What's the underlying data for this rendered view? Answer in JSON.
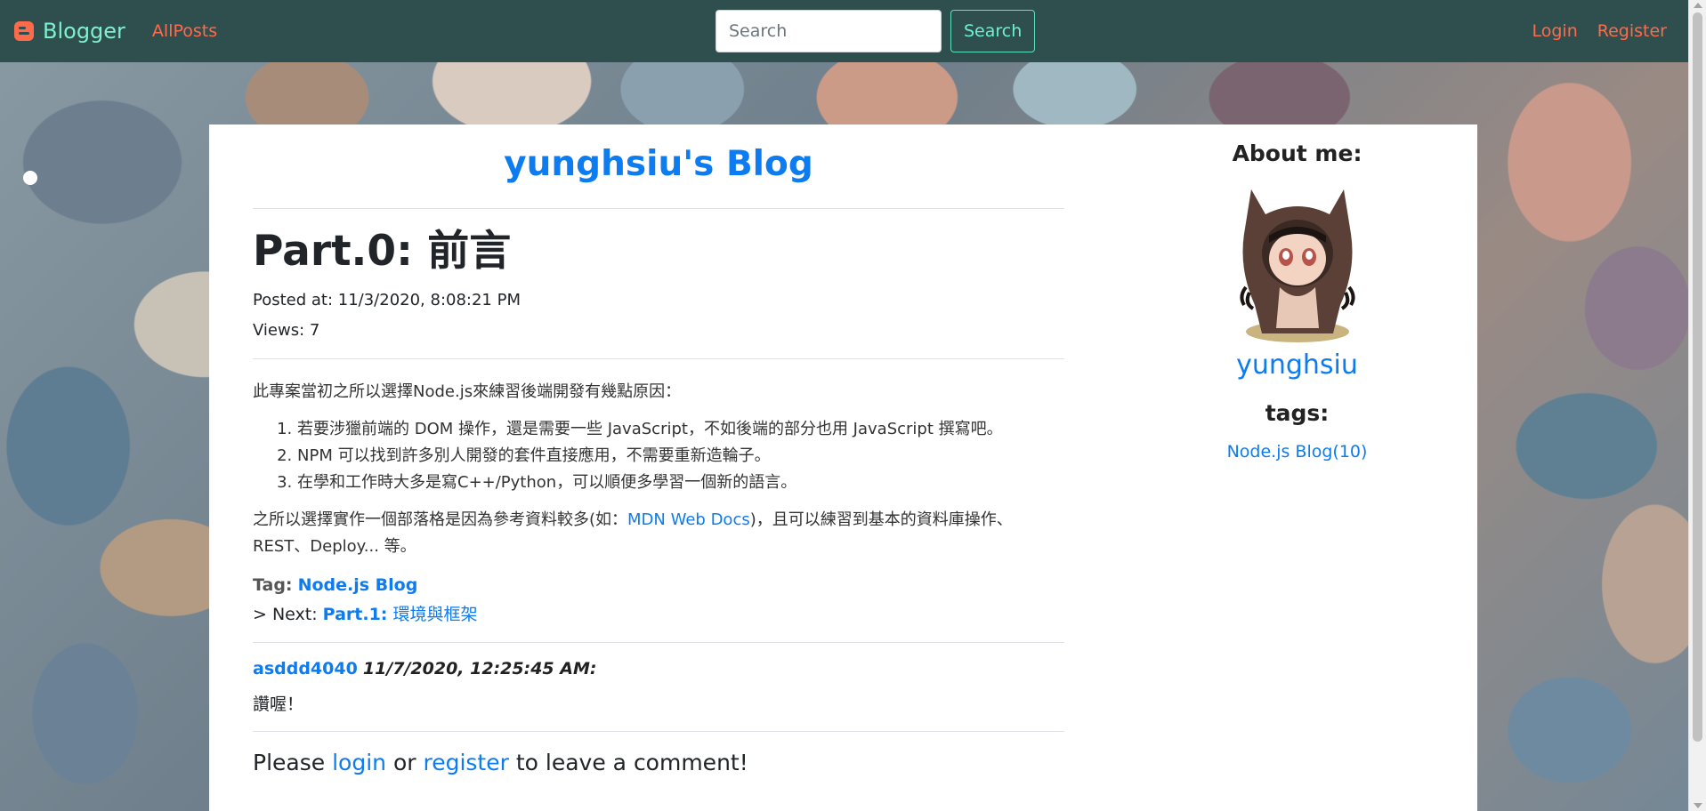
{
  "navbar": {
    "brand": "Blogger",
    "all_posts": "AllPosts",
    "search_placeholder": "Search",
    "search_button": "Search",
    "login": "Login",
    "register": "Register"
  },
  "blog": {
    "title": "yunghsiu's Blog"
  },
  "post": {
    "title": "Part.0: 前言",
    "posted_at": "Posted at: 11/3/2020, 8:08:21 PM",
    "views": "Views: 7",
    "intro": "此專案當初之所以選擇Node.js來練習後端開發有幾點原因：",
    "reasons": [
      "若要涉獵前端的 DOM 操作，還是需要一些 JavaScript，不如後端的部分也用 JavaScript 撰寫吧。",
      "NPM 可以找到許多別人開發的套件直接應用，不需要重新造輪子。",
      "在學和工作時大多是寫C++/Python，可以順便多學習一個新的語言。"
    ],
    "para2_before": "之所以選擇實作一個部落格是因為參考資料較多(如：",
    "para2_link": "MDN Web Docs",
    "para2_after": ")，且可以練習到基本的資料庫操作、REST、Deploy... 等。",
    "tag_label": "Tag:",
    "tag_value": "Node.js Blog",
    "next_label": "> Next:",
    "next_part": "Part.1:",
    "next_title": "環境與框架"
  },
  "comment": {
    "author": "asddd4040",
    "time": "11/7/2020, 12:25:45 AM",
    "colon": ":",
    "body": "讚喔！"
  },
  "leave_comment": {
    "please": "Please",
    "login": "login",
    "or": "or",
    "register": "register",
    "rest": "to leave a comment!"
  },
  "sidebar": {
    "about_label": "About me:",
    "username": "yunghsiu",
    "tags_label": "tags:",
    "tags": [
      "Node.js Blog(10)"
    ]
  },
  "colors": {
    "navbar_bg": "#2f4f4f",
    "brand": "#7ff0d0",
    "nav_link": "#ff6b4a",
    "link": "#0d7cf0"
  },
  "icons": {
    "brand": "blogger-icon",
    "avatar": "octocat-avatar"
  }
}
